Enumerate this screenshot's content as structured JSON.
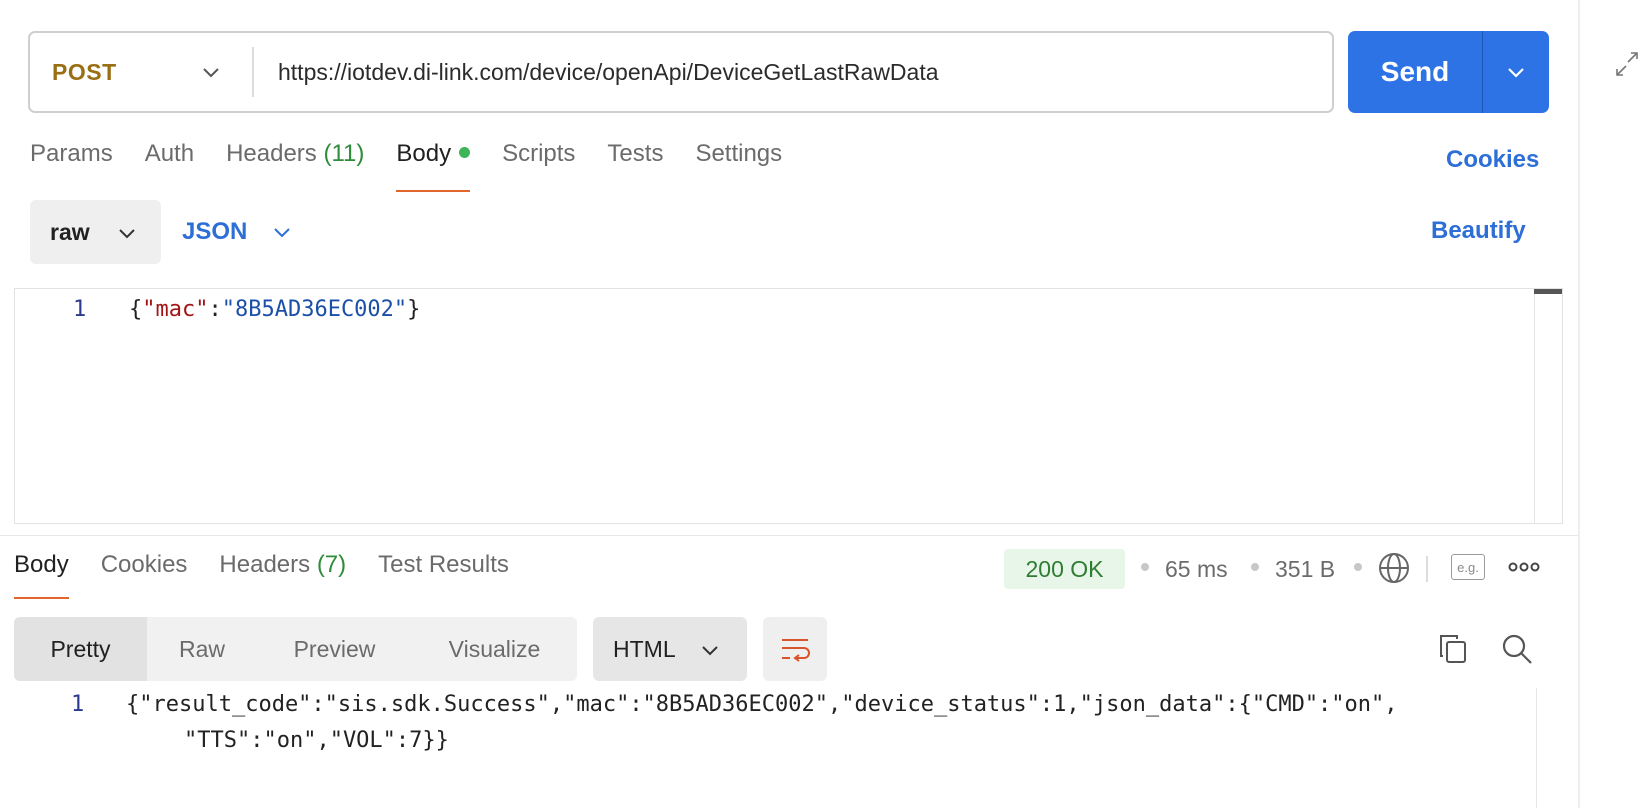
{
  "request": {
    "method": "POST",
    "url": "https://iotdev.di-link.com/device/openApi/DeviceGetLastRawData",
    "send_label": "Send"
  },
  "request_tabs": {
    "params": "Params",
    "auth": "Auth",
    "headers": "Headers",
    "headers_count": "(11)",
    "body": "Body",
    "scripts": "Scripts",
    "tests": "Tests",
    "settings": "Settings",
    "cookies": "Cookies"
  },
  "body_options": {
    "mode": "raw",
    "language": "JSON",
    "beautify": "Beautify"
  },
  "editor": {
    "line_number": "1",
    "code": {
      "open": "{",
      "key": "\"mac\"",
      "colon": ":",
      "value": "\"8B5AD36EC002\"",
      "close": "}"
    }
  },
  "response_tabs": {
    "body": "Body",
    "cookies": "Cookies",
    "headers": "Headers",
    "headers_count": "(7)",
    "test_results": "Test Results"
  },
  "response_meta": {
    "status": "200 OK",
    "time": "65 ms",
    "size": "351 B",
    "example_label": "e.g."
  },
  "response_view": {
    "pretty": "Pretty",
    "raw": "Raw",
    "preview": "Preview",
    "visualize": "Visualize",
    "format": "HTML"
  },
  "response_body": {
    "line_number": "1",
    "line1": "{\"result_code\":\"sis.sdk.Success\",\"mac\":\"8B5AD36EC002\",\"device_status\":1,\"json_data\":{\"CMD\":\"on\",",
    "line2": "\"TTS\":\"on\",\"VOL\":7}}"
  },
  "colors": {
    "accent": "#2d73e6",
    "method": "#9a6f14",
    "active_tab": "#e2652c",
    "success": "#2e7d32"
  }
}
